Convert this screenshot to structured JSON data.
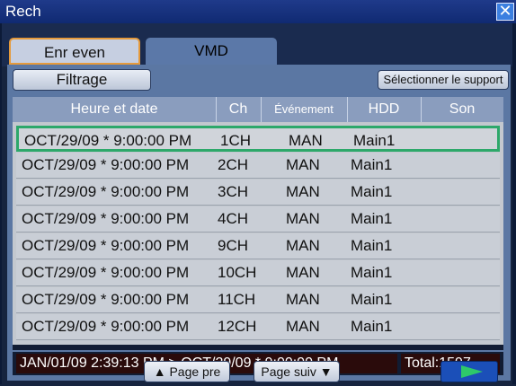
{
  "window": {
    "title": "Rech",
    "close_icon": "close-icon"
  },
  "tabs": [
    {
      "label": "Enr even",
      "active": true
    },
    {
      "label": "VMD",
      "active": false
    }
  ],
  "toolbar": {
    "filter_label": "Filtrage",
    "support_label": "Sélectionner le support"
  },
  "table": {
    "headers": [
      "Heure et date",
      "Ch",
      "Événement",
      "HDD",
      "Son"
    ],
    "rows": [
      {
        "date": "OCT/29/09 * 9:00:00 PM",
        "ch": "1CH",
        "event": "MAN",
        "hdd": "Main1",
        "son": ""
      },
      {
        "date": "OCT/29/09 * 9:00:00 PM",
        "ch": "2CH",
        "event": "MAN",
        "hdd": "Main1",
        "son": ""
      },
      {
        "date": "OCT/29/09 * 9:00:00 PM",
        "ch": "3CH",
        "event": "MAN",
        "hdd": "Main1",
        "son": ""
      },
      {
        "date": "OCT/29/09 * 9:00:00 PM",
        "ch": "4CH",
        "event": "MAN",
        "hdd": "Main1",
        "son": ""
      },
      {
        "date": "OCT/29/09 * 9:00:00 PM",
        "ch": "9CH",
        "event": "MAN",
        "hdd": "Main1",
        "son": ""
      },
      {
        "date": "OCT/29/09 * 9:00:00 PM",
        "ch": "10CH",
        "event": "MAN",
        "hdd": "Main1",
        "son": ""
      },
      {
        "date": "OCT/29/09 * 9:00:00 PM",
        "ch": "11CH",
        "event": "MAN",
        "hdd": "Main1",
        "son": ""
      },
      {
        "date": "OCT/29/09 * 9:00:00 PM",
        "ch": "12CH",
        "event": "MAN",
        "hdd": "Main1",
        "son": ""
      }
    ],
    "selected_index": 0
  },
  "status": {
    "range": "JAN/01/09  2:39:13 PM > OCT/29/09 * 9:00:00 PM",
    "total": "Total:1597"
  },
  "pager": {
    "prev_label": "Page pre",
    "next_label": "Page suiv",
    "play_icon": "play-icon"
  },
  "colors": {
    "selection_border": "#2da86a",
    "play_arrow": "#2ec86a",
    "active_tab_border": "#e59a3c"
  }
}
